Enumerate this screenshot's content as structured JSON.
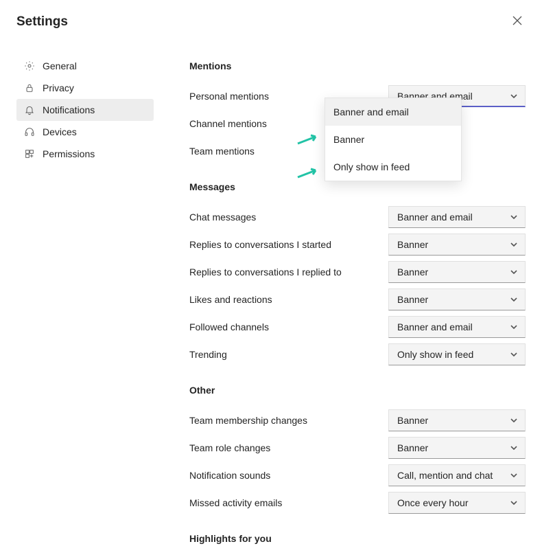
{
  "header": {
    "title": "Settings"
  },
  "sidebar": {
    "items": [
      {
        "label": "General"
      },
      {
        "label": "Privacy"
      },
      {
        "label": "Notifications"
      },
      {
        "label": "Devices"
      },
      {
        "label": "Permissions"
      }
    ]
  },
  "sections": {
    "mentions": {
      "heading": "Mentions",
      "personal_mentions": {
        "label": "Personal mentions",
        "value": "Banner and email"
      },
      "channel_mentions": {
        "label": "Channel mentions"
      },
      "team_mentions": {
        "label": "Team mentions"
      }
    },
    "messages": {
      "heading": "Messages",
      "chat_messages": {
        "label": "Chat messages",
        "value": "Banner and email"
      },
      "replies_started": {
        "label": "Replies to conversations I started",
        "value": "Banner"
      },
      "replies_replied": {
        "label": "Replies to conversations I replied to",
        "value": "Banner"
      },
      "likes_reactions": {
        "label": "Likes and reactions",
        "value": "Banner"
      },
      "followed_channels": {
        "label": "Followed channels",
        "value": "Banner and email"
      },
      "trending": {
        "label": "Trending",
        "value": "Only show in feed"
      }
    },
    "other": {
      "heading": "Other",
      "team_membership": {
        "label": "Team membership changes",
        "value": "Banner"
      },
      "team_role": {
        "label": "Team role changes",
        "value": "Banner"
      },
      "notif_sounds": {
        "label": "Notification sounds",
        "value": "Call, mention and chat"
      },
      "missed_emails": {
        "label": "Missed activity emails",
        "value": "Once every hour"
      }
    },
    "highlights": {
      "heading": "Highlights for you"
    }
  },
  "dropdown": {
    "options": [
      {
        "label": "Banner and email"
      },
      {
        "label": "Banner"
      },
      {
        "label": "Only show in feed"
      }
    ]
  }
}
